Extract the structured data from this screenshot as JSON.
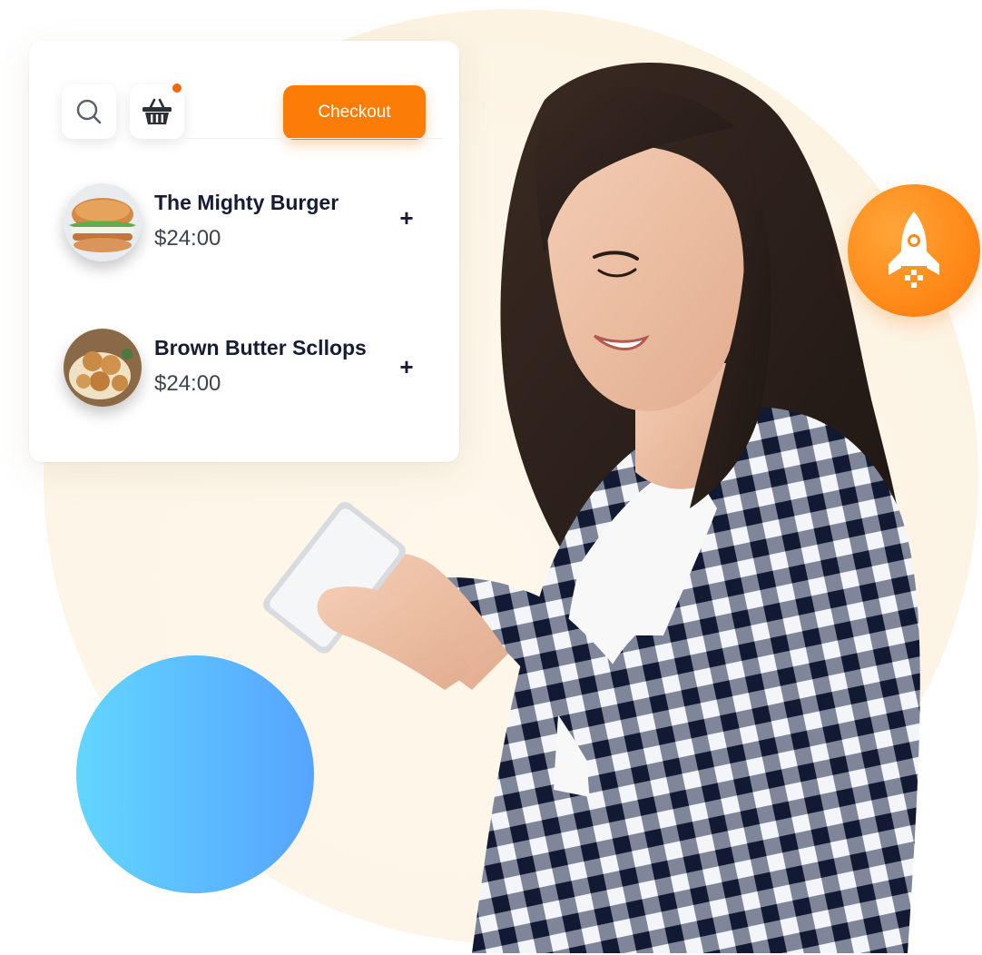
{
  "toolbar": {
    "search_icon": "search-icon",
    "basket_icon": "basket-icon",
    "checkout_label": "Checkout"
  },
  "cart": {
    "items": [
      {
        "name": "The Mighty Burger",
        "price": "$24:00",
        "add_label": "+"
      },
      {
        "name": "Brown Butter Scllops",
        "price": "$24:00",
        "add_label": "+"
      }
    ]
  },
  "badge": {
    "icon": "rocket-icon"
  },
  "colors": {
    "accent_orange": "#fb7c07",
    "notification_dot": "#f6670c",
    "title_text": "#161c36",
    "blue_gradient_start": "#62d6ff",
    "blue_gradient_end": "#56a4ff"
  }
}
